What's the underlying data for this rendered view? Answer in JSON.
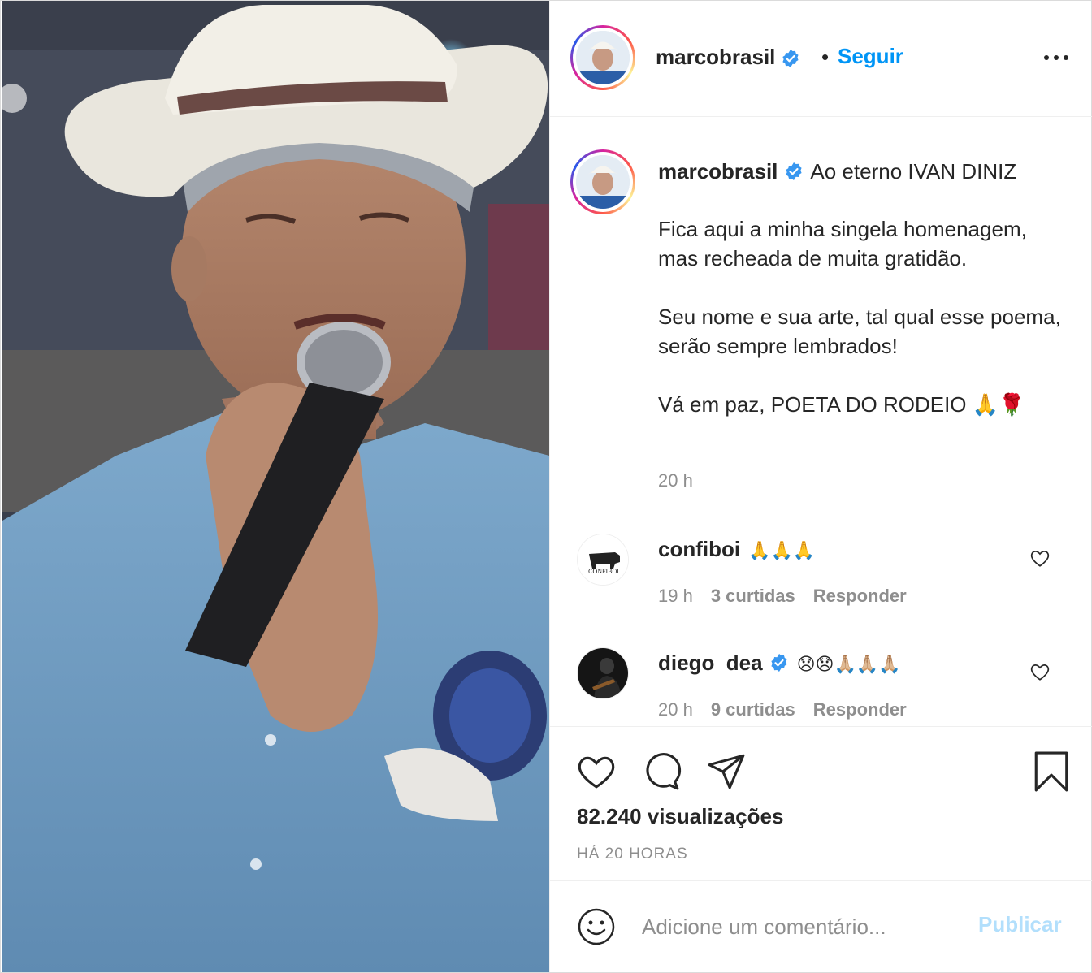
{
  "post": {
    "username": "marcobrasil",
    "separator": "•",
    "follow_label": "Seguir",
    "more_icon": "more-options-icon"
  },
  "caption": {
    "username": "marcobrasil",
    "first_line": "Ao eterno IVAN DINIZ",
    "paragraphs": [
      "Fica aqui a minha singela homenagem, mas recheada de muita gratidão.",
      "Seu nome e sua arte, tal qual esse poema, serão sempre lembrados!",
      "Vá em paz, POETA DO RODEIO 🙏🌹"
    ],
    "time": "20 h"
  },
  "comments": [
    {
      "username": "confiboi",
      "text": "🙏🙏🙏",
      "time": "19 h",
      "likes": "3 curtidas",
      "reply": "Responder",
      "verified": false,
      "avatar_text": "CONFIBOI"
    },
    {
      "username": "diego_dea",
      "text": "😞😞🙏🏼🙏🏼🙏🏼",
      "time": "20 h",
      "likes": "9 curtidas",
      "reply": "Responder",
      "verified": true
    }
  ],
  "actions": {
    "views": "82.240 visualizações",
    "posted_ago": "HÁ 20 HORAS"
  },
  "add_comment": {
    "placeholder": "Adicione um comentário...",
    "publish_label": "Publicar"
  },
  "colors": {
    "link_blue": "#0095f6",
    "publish_disabled": "#b2dffc",
    "muted": "#8e8e8e",
    "text": "#262626"
  }
}
